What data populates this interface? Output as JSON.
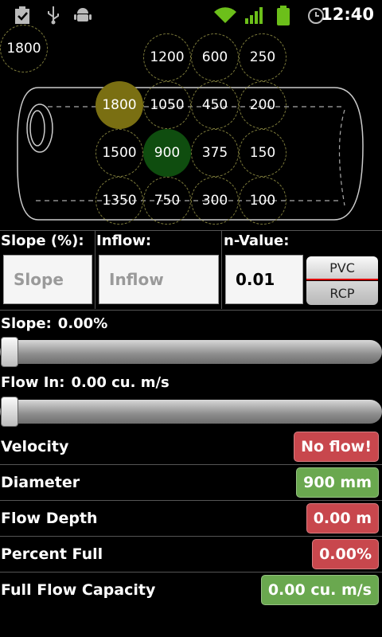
{
  "status_bar": {
    "time": "12:40",
    "icons": [
      "clipboard-check-icon",
      "usb-icon",
      "android-debug-icon",
      "wifi-icon",
      "signal-icon",
      "battery-icon",
      "alarm-icon"
    ]
  },
  "diagram": {
    "standalone_size": "1800",
    "grid": [
      [
        "1200",
        "600",
        "250"
      ],
      [
        "1800",
        "1050",
        "450",
        "200"
      ],
      [
        "1500",
        "900",
        "375",
        "150"
      ],
      [
        "1350",
        "750",
        "300",
        "100"
      ]
    ],
    "selected": [
      "1800",
      "900"
    ]
  },
  "inputs": {
    "slope_header": "Slope (%):",
    "inflow_header": "Inflow:",
    "nvalue_header": "n-Value:",
    "slope_placeholder": "Slope",
    "inflow_placeholder": "Inflow",
    "nvalue_value": "0.01",
    "pvc_label": "PVC",
    "rcp_label": "RCP"
  },
  "sliders": {
    "slope_label": "Slope:",
    "slope_value": "0.00%",
    "slope_fraction": 0,
    "flow_label": "Flow In:",
    "flow_value": "0.00 cu. m/s",
    "flow_fraction": 0
  },
  "results": [
    {
      "label": "Velocity",
      "value": "No flow!",
      "status": "red"
    },
    {
      "label": "Diameter",
      "value": "900 mm",
      "status": "green"
    },
    {
      "label": "Flow Depth",
      "value": "0.00 m",
      "status": "red"
    },
    {
      "label": "Percent Full",
      "value": "0.00%",
      "status": "red"
    },
    {
      "label": "Full Flow Capacity",
      "value": "0.00 cu. m/s",
      "status": "green"
    }
  ],
  "colors": {
    "selected_olive": "#7a6f12",
    "selected_green": "#0f4d0f",
    "badge_red": "#c8474d",
    "badge_green": "#6aa84f"
  }
}
